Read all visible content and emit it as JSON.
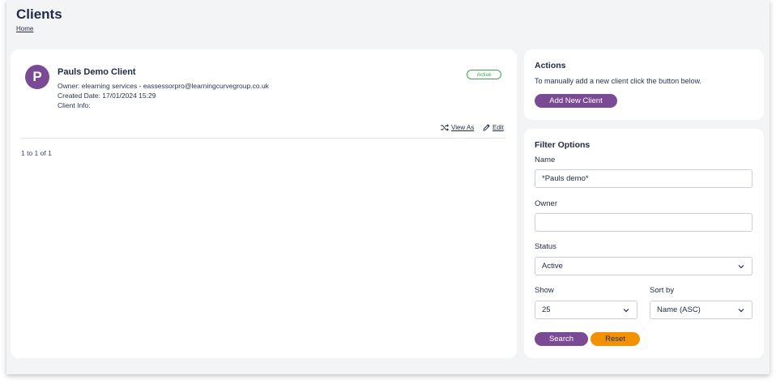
{
  "header": {
    "title": "Clients",
    "breadcrumb": "Home"
  },
  "client": {
    "initial": "P",
    "name": "Pauls Demo Client",
    "owner_line": "Owner: elearning services - eassessorpro@learningcurvegroup.co.uk",
    "created_line": "Created Date: 17/01/2024 15:29",
    "info_line": "Client Info:",
    "status": "Active",
    "view_as_label": "View As",
    "edit_label": "Edit"
  },
  "pager": {
    "text": "1 to 1 of 1"
  },
  "actions": {
    "title": "Actions",
    "description": "To manually add a new client click the button below.",
    "add_label": "Add New Client"
  },
  "filter": {
    "title": "Filter Options",
    "name_label": "Name",
    "name_value": "*Pauls demo*",
    "owner_label": "Owner",
    "owner_value": "",
    "status_label": "Status",
    "status_value": "Active",
    "show_label": "Show",
    "show_value": "25",
    "sort_label": "Sort by",
    "sort_value": "Name (ASC)",
    "search_label": "Search",
    "reset_label": "Reset"
  },
  "colors": {
    "brand": "#7b4a94",
    "reset": "#f39200",
    "active": "#3fa34d",
    "text": "#1f2a44"
  }
}
